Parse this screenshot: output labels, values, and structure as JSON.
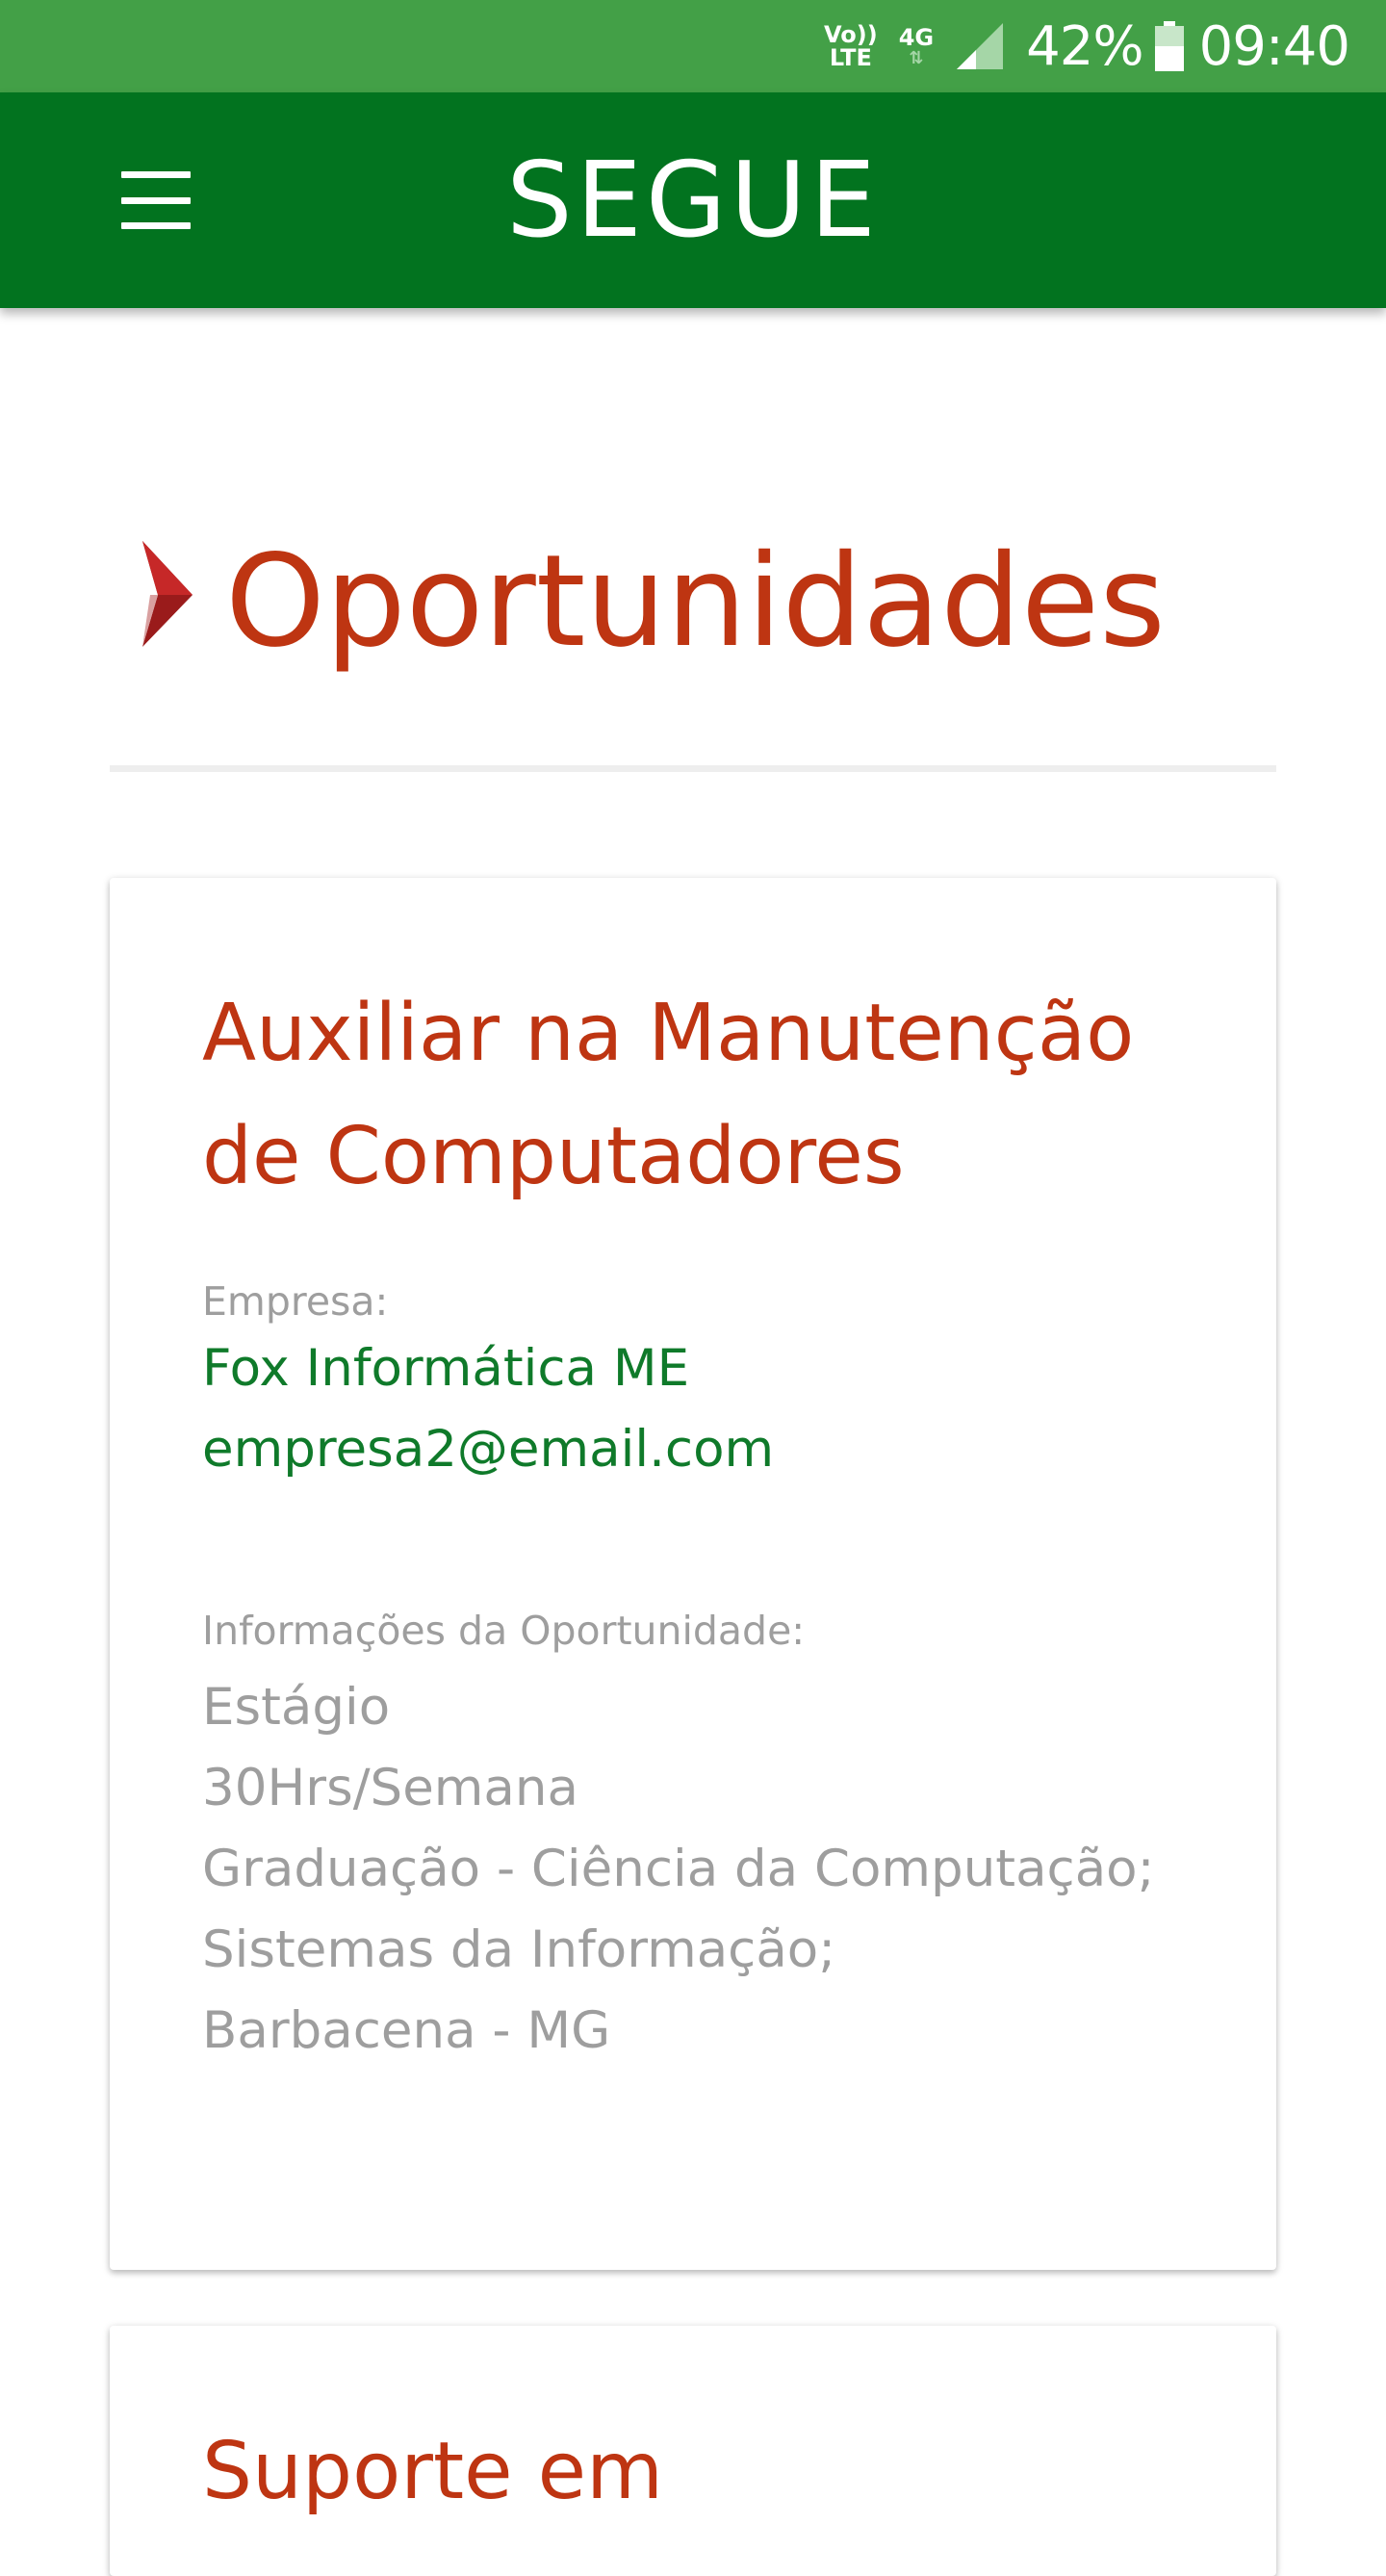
{
  "status_bar": {
    "volte_top": "Vo))",
    "volte_bottom": "LTE",
    "network": "4G",
    "battery": "42%",
    "time": "09:40"
  },
  "app_bar": {
    "title": "SEGUE",
    "menu_icon": "hamburger-menu-icon"
  },
  "page": {
    "title": "Oportunidades",
    "title_icon": "chevron-right-icon"
  },
  "opportunities": [
    {
      "title": "Auxiliar na Manutenção de Computadores",
      "company_label": "Empresa:",
      "company_name": "Fox Informática ME",
      "company_email": "empresa2@email.com",
      "info_label": "Informações da Oportunidade:",
      "info": [
        "Estágio",
        "30Hrs/Semana",
        "Graduação - Ciência da Computação;",
        "Sistemas da Informação;",
        "Barbacena - MG"
      ]
    },
    {
      "title": "Suporte em"
    }
  ],
  "colors": {
    "status_bar": "#43a047",
    "app_bar": "#02731f",
    "accent_red": "#be3512",
    "company_green": "#0f7a2a",
    "muted_text": "#9e9e9e"
  }
}
